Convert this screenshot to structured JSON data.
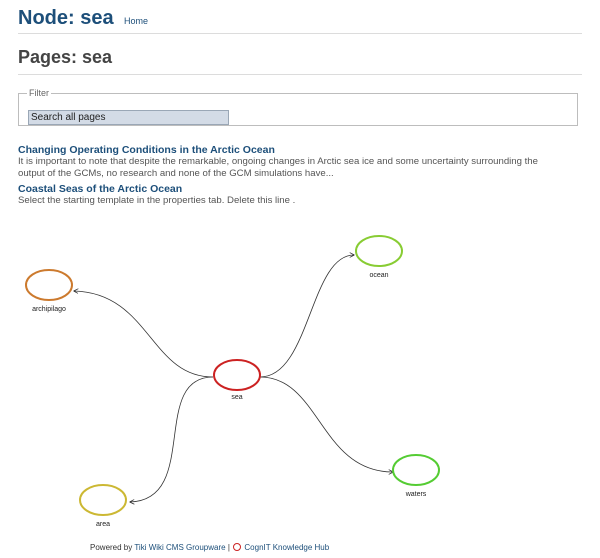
{
  "header": {
    "title": "Node: sea",
    "home_link": "Home"
  },
  "pages_title": "Pages: sea",
  "filter": {
    "legend": "Filter",
    "search_value": "Search all pages"
  },
  "results": [
    {
      "title": "Changing Operating Conditions in the Arctic Ocean",
      "snippet_line1": "It is important to note that despite the remarkable, ongoing changes in Arctic sea ice and some uncertainty surrounding the",
      "snippet_line2": "output of the GCMs, no research and none of the GCM simulations have..."
    },
    {
      "title": "Coastal Seas of the Arctic Ocean",
      "snippet_line1": "Select the starting template in the properties tab. Delete this line ."
    }
  ],
  "graph": {
    "nodes": [
      {
        "id": "sea",
        "label": "sea",
        "color": "#cc2222"
      },
      {
        "id": "ocean",
        "label": "ocean",
        "color": "#88cc33"
      },
      {
        "id": "archipilago",
        "label": "archipilago",
        "color": "#cc7a2e"
      },
      {
        "id": "waters",
        "label": "waters",
        "color": "#55cc33"
      },
      {
        "id": "area",
        "label": "area",
        "color": "#ccb833"
      }
    ],
    "edges": [
      {
        "from": "sea",
        "to": "ocean"
      },
      {
        "from": "sea",
        "to": "archipilago"
      },
      {
        "from": "sea",
        "to": "waters"
      },
      {
        "from": "sea",
        "to": "area"
      }
    ]
  },
  "footer": {
    "powered_by": "Powered by",
    "tiki_link": "Tiki Wiki CMS Groupware",
    "separator": "|",
    "cognit_link": "CognIT Knowledge Hub",
    "cognit_icon_color": "#cc2222"
  }
}
